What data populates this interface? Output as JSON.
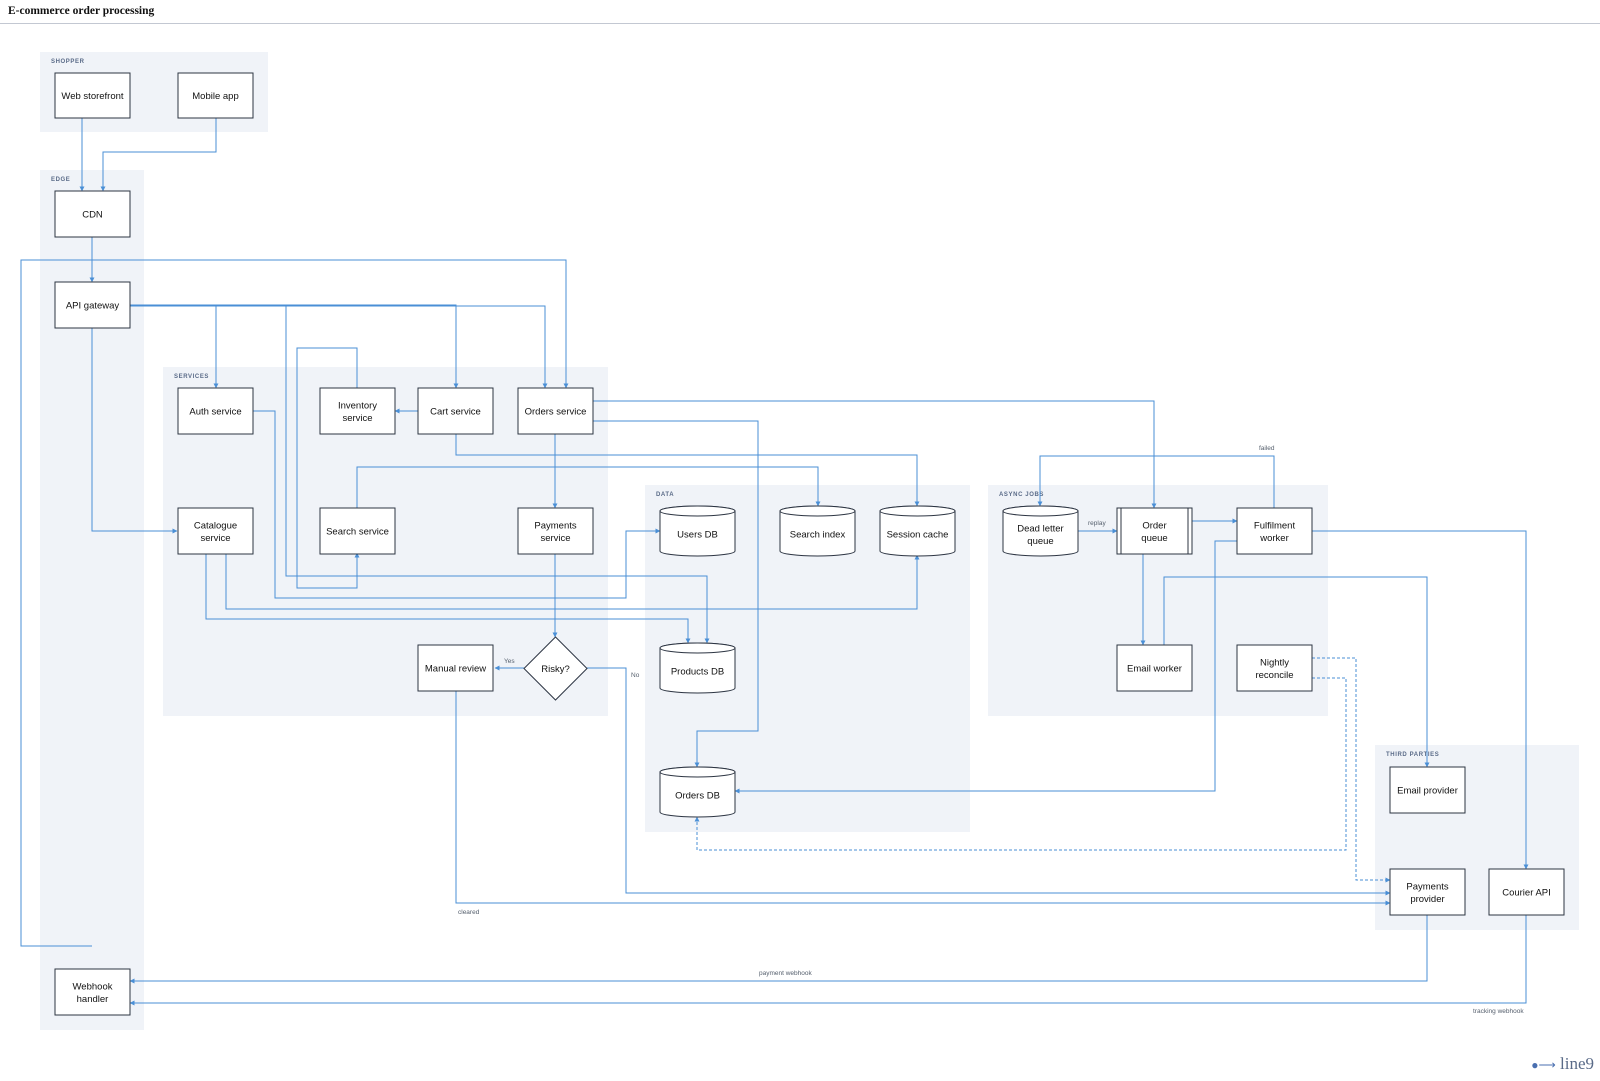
{
  "title": "E-commerce order processing",
  "brand": "line9",
  "colors": {
    "edge": "#4a8fd6",
    "group_fill": "#f0f3f8",
    "node_stroke": "#2c3442"
  },
  "groups": {
    "shopper": "SHOPPER",
    "edge": "EDGE",
    "services": "SERVICES",
    "data": "DATA",
    "async": "ASYNC JOBS",
    "third": "THIRD PARTIES"
  },
  "nodes": {
    "web": [
      "Web storefront"
    ],
    "mobile": [
      "Mobile app"
    ],
    "cdn": [
      "CDN"
    ],
    "api": [
      "API gateway"
    ],
    "webhook": [
      "Webhook",
      "handler"
    ],
    "auth": [
      "Auth service"
    ],
    "inventory": [
      "Inventory",
      "service"
    ],
    "cart": [
      "Cart service"
    ],
    "orders": [
      "Orders service"
    ],
    "catalogue": [
      "Catalogue",
      "service"
    ],
    "search": [
      "Search service"
    ],
    "payments": [
      "Payments",
      "service"
    ],
    "manual": [
      "Manual review"
    ],
    "risky": [
      "Risky?"
    ],
    "usersdb": [
      "Users DB"
    ],
    "searchidx": [
      "Search index"
    ],
    "session": [
      "Session cache"
    ],
    "productsdb": [
      "Products DB"
    ],
    "ordersdb": [
      "Orders DB"
    ],
    "dlq": [
      "Dead letter",
      "queue"
    ],
    "orderq": [
      "Order",
      "queue"
    ],
    "fulfil": [
      "Fulfilment",
      "worker"
    ],
    "email": [
      "Email worker"
    ],
    "nightly": [
      "Nightly",
      "reconcile"
    ],
    "emailprov": [
      "Email provider"
    ],
    "payprov": [
      "Payments",
      "provider"
    ],
    "courier": [
      "Courier API"
    ]
  },
  "edge_labels": {
    "failed": "failed",
    "replay": "replay",
    "yes": "Yes",
    "no": "No",
    "cleared": "cleared",
    "payment_webhook": "payment webhook",
    "tracking_webhook": "tracking webhook"
  }
}
